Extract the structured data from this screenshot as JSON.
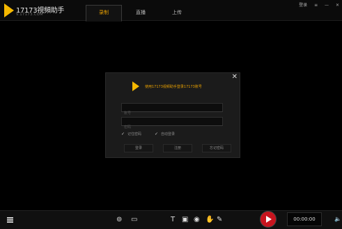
{
  "app": {
    "logo_text": "17173視頻助手",
    "logo_sub": "V.17173.COM"
  },
  "tabs": [
    {
      "label": "录制",
      "active": true
    },
    {
      "label": "直播",
      "active": false
    },
    {
      "label": "上传",
      "active": false
    }
  ],
  "window_controls": {
    "login": "登录",
    "menu": "≡",
    "minimize": "—",
    "close": "✕"
  },
  "dialog": {
    "title": "使用17173视频助手登录17173账号",
    "username_placeholder": "账号",
    "password_placeholder": "密码",
    "remember_password": "记住密码",
    "auto_login": "自动登录",
    "login_button": "登录",
    "register_button": "注册",
    "forgot_button": "忘记密码",
    "close": "✕"
  },
  "bottombar": {
    "timer": "00:00:00",
    "volume": "🔈",
    "tools": [
      {
        "icon": "camera-icon",
        "glyph": "⊚"
      },
      {
        "icon": "screen-icon",
        "glyph": "▭"
      },
      {
        "icon": "text-icon",
        "glyph": "T"
      },
      {
        "icon": "image-icon",
        "glyph": "▣"
      },
      {
        "icon": "webcam-icon",
        "glyph": "◉"
      },
      {
        "icon": "hand-icon",
        "glyph": "✋"
      },
      {
        "icon": "brush-icon",
        "glyph": "✎"
      }
    ]
  },
  "colors": {
    "accent": "#e8a000",
    "record": "#c8141e",
    "logo": "#f5b800"
  }
}
